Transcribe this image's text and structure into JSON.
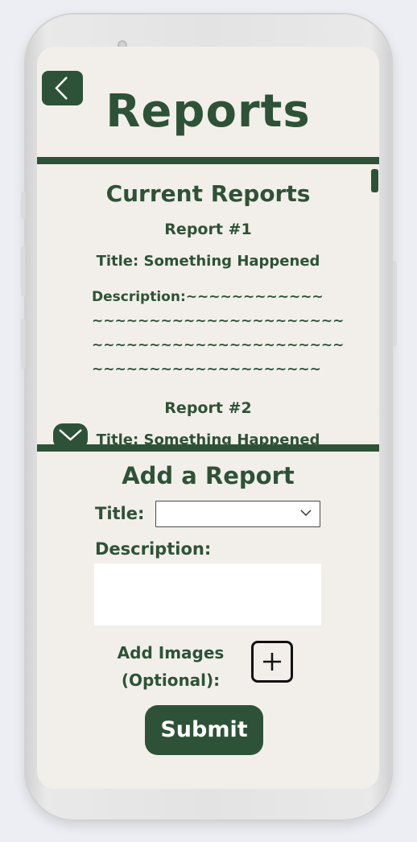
{
  "header": {
    "title": "Reports",
    "back_icon": "chevron-left-icon"
  },
  "current_reports": {
    "heading": "Current Reports",
    "reports": [
      {
        "number": "Report #1",
        "title": "Title: Something Happened",
        "description": "Description:~~~~~~~~~~~~\n~~~~~~~~~~~~~~~~~~~~~~\n~~~~~~~~~~~~~~~~~~~~~~\n~~~~~~~~~~~~~~~~~~~~"
      },
      {
        "number": "Report #2",
        "title": "Title: Something Happened"
      }
    ],
    "expand_icon": "chevron-down-icon"
  },
  "add_report": {
    "heading": "Add a Report",
    "title_label": "Title:",
    "title_value": "",
    "description_label": "Description:",
    "description_value": "",
    "images_label_line1": "Add Images",
    "images_label_line2": "(Optional):",
    "add_image_icon": "plus-icon",
    "submit_label": "Submit"
  },
  "colors": {
    "primary": "#2e5237",
    "background": "#f2efea"
  }
}
